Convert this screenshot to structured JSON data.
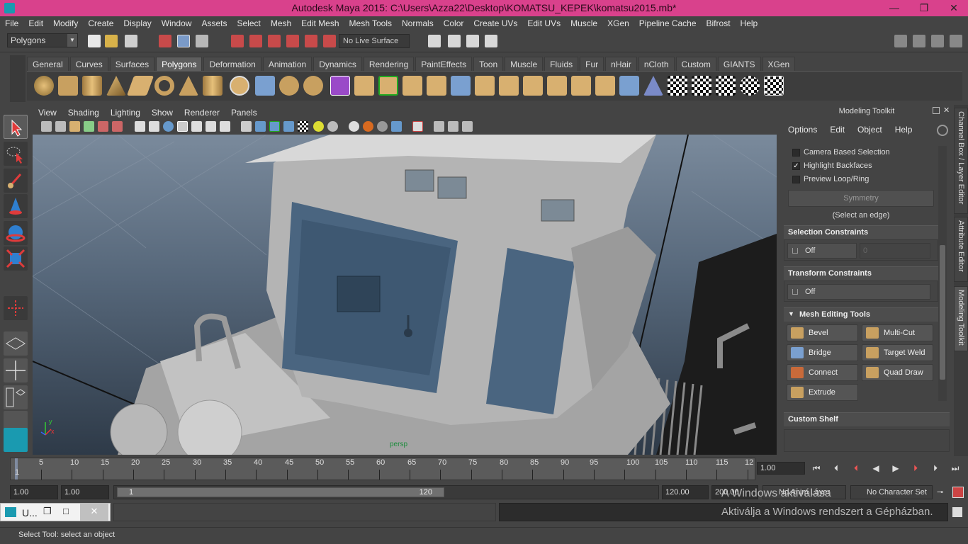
{
  "window": {
    "title": "Autodesk Maya 2015: C:\\Users\\Azza22\\Desktop\\KOMATSU_KEPEK\\komatsu2015.mb*",
    "minimize_glyph": "—",
    "restore_glyph": "❐",
    "close_glyph": "✕"
  },
  "menubar": [
    "File",
    "Edit",
    "Modify",
    "Create",
    "Display",
    "Window",
    "Assets",
    "Select",
    "Mesh",
    "Edit Mesh",
    "Mesh Tools",
    "Normals",
    "Color",
    "Create UVs",
    "Edit UVs",
    "Muscle",
    "XGen",
    "Pipeline Cache",
    "Bifrost",
    "Help"
  ],
  "statusline": {
    "mode": "Polygons",
    "live_surface": "No Live Surface"
  },
  "shelf": {
    "tabs": [
      "General",
      "Curves",
      "Surfaces",
      "Polygons",
      "Deformation",
      "Animation",
      "Dynamics",
      "Rendering",
      "PaintEffects",
      "Toon",
      "Muscle",
      "Fluids",
      "Fur",
      "nHair",
      "nCloth",
      "Custom",
      "GIANTS",
      "XGen"
    ],
    "active_tab": "Polygons"
  },
  "viewport": {
    "menu": [
      "View",
      "Shading",
      "Lighting",
      "Show",
      "Renderer",
      "Panels"
    ],
    "axis_x": "x",
    "axis_y": "y",
    "camera_label": "persp"
  },
  "toolkit": {
    "header": "Modeling Toolkit",
    "menu": [
      "Options",
      "Edit",
      "Object",
      "Help"
    ],
    "checkboxes": [
      {
        "label": "Camera Based Selection",
        "checked": false
      },
      {
        "label": "Highlight Backfaces",
        "checked": true
      },
      {
        "label": "Preview Loop/Ring",
        "checked": false
      }
    ],
    "symmetry_button": "Symmetry",
    "symmetry_hint": "(Select an edge)",
    "selection_constraints": {
      "title": "Selection Constraints",
      "value": "Off",
      "amount": "0"
    },
    "transform_constraints": {
      "title": "Transform Constraints",
      "value": "Off"
    },
    "mesh_editing_tools": {
      "title": "Mesh Editing Tools",
      "tools": [
        "Bevel",
        "Multi-Cut",
        "Bridge",
        "Target Weld",
        "Connect",
        "Quad Draw",
        "Extrude"
      ]
    },
    "custom_shelf": "Custom Shelf"
  },
  "side_tabs": [
    "Channel Box / Layer Editor",
    "Attribute Editor",
    "Modeling Toolkit"
  ],
  "timeline": {
    "ticks": [
      "1",
      "5",
      "10",
      "15",
      "20",
      "25",
      "30",
      "35",
      "40",
      "45",
      "50",
      "55",
      "60",
      "65",
      "70",
      "75",
      "80",
      "85",
      "90",
      "95",
      "100",
      "105",
      "110",
      "115",
      "12"
    ],
    "current_frame": "1.00"
  },
  "range": {
    "start_time": "1.00",
    "playback_start": "1.00",
    "range_start": "1",
    "range_end": "120",
    "playback_end": "120.00",
    "end_time": "200.00",
    "anim_layer": "No Anim Layer",
    "character_set": "No Character Set"
  },
  "cmdline": {
    "mel_label": "U..."
  },
  "windows_watermark": {
    "line1": "A Windows aktiválása",
    "line2": "Aktiválja a Windows rendszert a Gépházban."
  },
  "helpline": "Select Tool: select an object",
  "colors": {
    "titlebar": "#d9418c",
    "background": "#444444",
    "accent_selected": "#5e5e5e"
  }
}
